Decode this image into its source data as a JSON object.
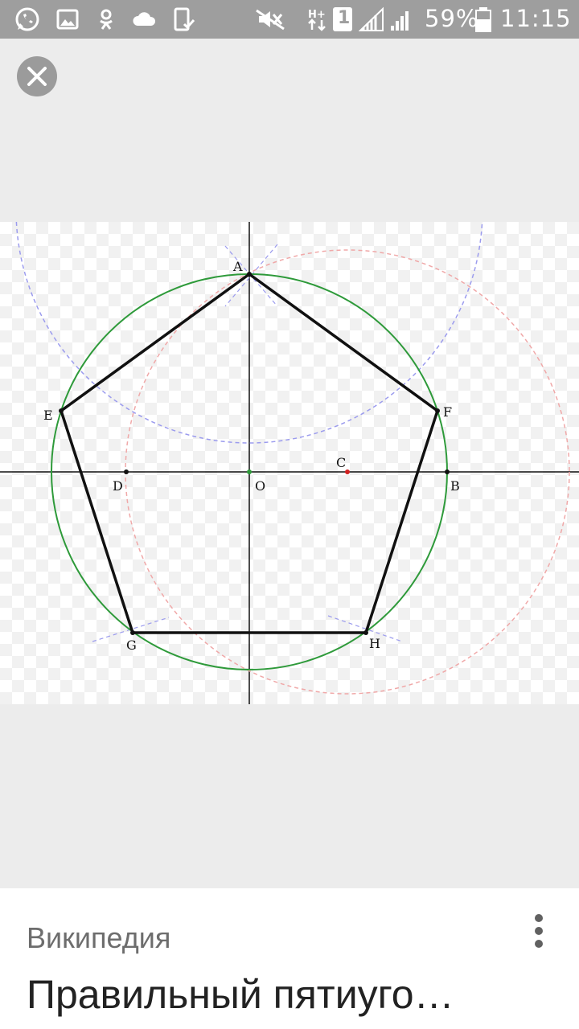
{
  "status_bar": {
    "battery_percent": "59%",
    "time": "11:15",
    "sim_slot": "1",
    "network_type": "H+",
    "icons": [
      "whatsapp-icon",
      "gallery-icon",
      "odnoklassniki-icon",
      "cloud-icon",
      "screenshot-icon",
      "mute-icon",
      "network-arrows-icon",
      "sim-icon",
      "signal-icon",
      "signal-icon",
      "battery-icon"
    ]
  },
  "viewer": {
    "close_icon": "close-icon"
  },
  "figure": {
    "point_labels": {
      "A": "A",
      "B": "B",
      "C": "C",
      "D": "D",
      "E": "E",
      "F": "F",
      "G": "G",
      "H": "H",
      "O": "O"
    },
    "colors": {
      "circle": "#2e9a3a",
      "pentagon": "#111111",
      "construction_blue": "#9b9bee",
      "construction_red": "#f0a8a8",
      "center_point": "#2e9a3a",
      "point_c": "#d02020"
    }
  },
  "card": {
    "source": "Википедия",
    "title": "Правильный пятиуго…",
    "more_icon": "more-vert-icon"
  }
}
